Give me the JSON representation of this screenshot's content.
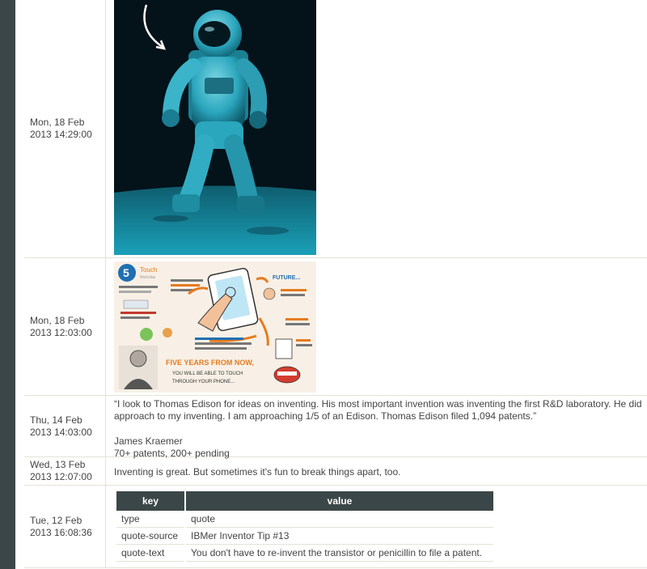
{
  "posts": [
    {
      "date_line1": "Mon, 18 Feb",
      "date_line2": "2013 14:29:00",
      "type": "photo",
      "image": "astronaut-photo"
    },
    {
      "date_line1": "Mon, 18 Feb",
      "date_line2": "2013 12:03:00",
      "type": "photo",
      "image": "5-in-5-touch-illustration",
      "image_text": {
        "badge": "5",
        "heading1": "Touch",
        "heading2": "Nicholas",
        "future": "FUTURE...",
        "quote_big": "FIVE YEARS FROM NOW,",
        "quote_line2": "YOU WILL BE ABLE TO TOUCH",
        "quote_line3": "THROUGH YOUR PHONE..."
      }
    },
    {
      "date_line1": "Thu, 14 Feb",
      "date_line2": "2013 14:03:00",
      "type": "quote",
      "quote_line1": "“I look to Thomas Edison for ideas on inventing. His most important invention was inventing the first R&D laboratory. He did",
      "quote_line2": "approach to my inventing. I am approaching 1/5 of an Edison. Thomas Edison filed 1,094 patents.”",
      "author": "James Kraemer",
      "author_note": "70+ patents, 200+ pending"
    },
    {
      "date_line1": "Wed, 13 Feb",
      "date_line2": "2013 12:07:00",
      "type": "text",
      "text": "Inventing is great. But sometimes it's fun to break things apart, too."
    },
    {
      "date_line1": "Tue, 12 Feb",
      "date_line2": "2013 16:08:36",
      "type": "table",
      "table": {
        "headers": [
          "key",
          "value"
        ],
        "rows": [
          {
            "key": "type",
            "value": "quote"
          },
          {
            "key": "quote-source",
            "value": "IBMer Inventor Tip #13"
          },
          {
            "key": "quote-text",
            "value": "You don't have to re-invent the transistor or penicillin to file a patent."
          }
        ]
      }
    }
  ],
  "colors": {
    "sidebar": "#3b4649",
    "divider": "#e4e2d6",
    "astronaut_tint": "#1aa0b8"
  }
}
